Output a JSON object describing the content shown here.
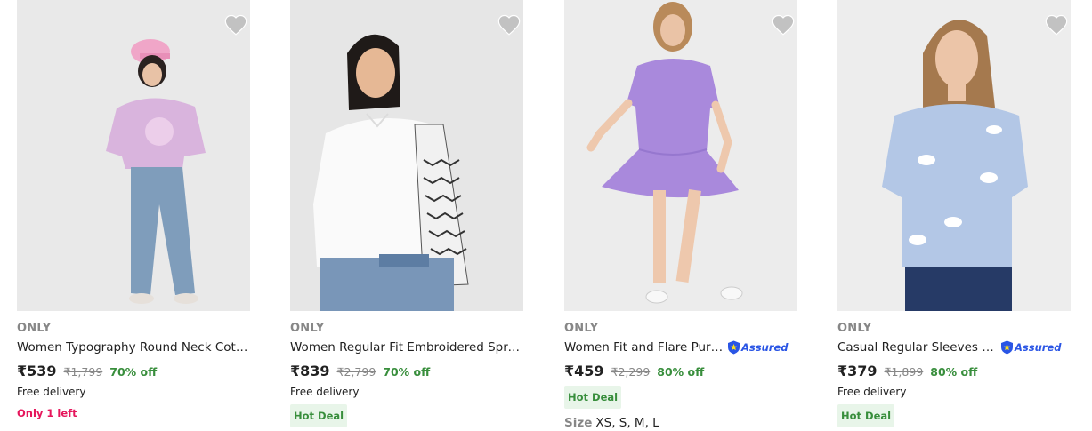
{
  "products": [
    {
      "brand": "ONLY",
      "title": "Women Typography Round Neck Cotton Blend Lavender T-Shirt",
      "price": "₹539",
      "mrp": "₹1,799",
      "discount": "70% off",
      "delivery": "Free delivery",
      "stock": "Only 1 left"
    },
    {
      "brand": "ONLY",
      "title": "Women Regular Fit Embroidered Spread Collar Casual Shirt",
      "price": "₹839",
      "mrp": "₹2,799",
      "discount": "70% off",
      "delivery": "Free delivery",
      "deal": "Hot Deal"
    },
    {
      "brand": "ONLY",
      "title": "Women Fit and Flare Purple Dress",
      "assured": "Assured",
      "price": "₹459",
      "mrp": "₹2,299",
      "discount": "80% off",
      "deal": "Hot Deal",
      "size_label": "Size",
      "sizes": "XS, S, M, L"
    },
    {
      "brand": "ONLY",
      "title": "Casual Regular Sleeves Printed Women Blue Top",
      "assured": "Assured",
      "price": "₹379",
      "mrp": "₹1,899",
      "discount": "80% off",
      "delivery": "Free delivery",
      "deal": "Hot Deal"
    }
  ],
  "icons": {
    "wishlist": "heart-icon",
    "assured": "assured-shield-icon"
  },
  "colors": {
    "brand_text": "#878787",
    "discount_green": "#388e3c",
    "stock_pink": "#e6175c",
    "assured_blue": "#2a55e5",
    "wishlist_grey": "#c2c2c2"
  }
}
